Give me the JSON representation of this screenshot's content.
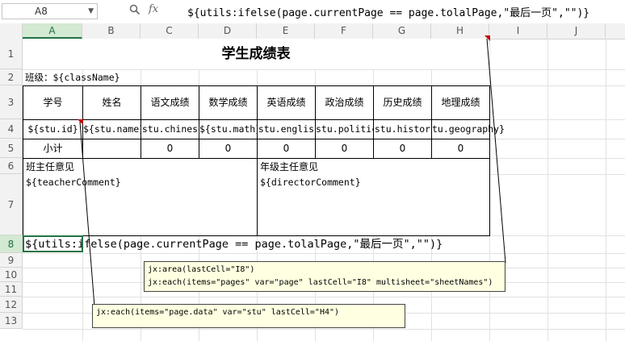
{
  "formula_bar": {
    "cell_ref": "A8",
    "search_icon": "magnifier-icon",
    "fx_label": "fx",
    "formula": "${utils:ifelse(page.currentPage == page.tolalPage,\"最后一页\",\"\")}"
  },
  "columns": [
    "A",
    "B",
    "C",
    "D",
    "E",
    "F",
    "G",
    "H",
    "I",
    "J"
  ],
  "rows": [
    "1",
    "2",
    "3",
    "4",
    "5",
    "6",
    "7",
    "8",
    "9",
    "10",
    "11",
    "12",
    "13"
  ],
  "sheet": {
    "title": "学生成绩表",
    "class_label": "班级：${className}",
    "headers": [
      "学号",
      "姓名",
      "语文成绩",
      "数学成绩",
      "英语成绩",
      "政治成绩",
      "历史成绩",
      "地理成绩"
    ],
    "data_row": [
      "${stu.id}",
      "${stu.name}",
      "stu.chines",
      "${stu.math}",
      "stu.englis",
      "stu.politic",
      "stu.histor",
      "tu.geography}"
    ],
    "subtotal_label": "小计",
    "subtotals": [
      "0",
      "0",
      "0",
      "0",
      "0",
      "0"
    ],
    "teacher_opinion_label": "班主任意见",
    "teacher_comment": "${teacherComment}",
    "director_opinion_label": "年级主任意见",
    "director_comment": "${directorComment}",
    "a8_formula": "${utils:ifelse(page.currentPage == page.tolalPage,\"最后一页\",\"\")}"
  },
  "comments": {
    "area_note_line1": "jx:area(lastCell=\"I8\")",
    "area_note_line2": "jx:each(items=\"pages\" var=\"page\" lastCell=\"I8\" multisheet=\"sheetNames\")",
    "each_note": "jx:each(items=\"page.data\" var=\"stu\" lastCell=\"H4\")"
  },
  "colors": {
    "accent": "#217346",
    "comment_bg": "#ffffe1",
    "marker": "#c00000"
  }
}
